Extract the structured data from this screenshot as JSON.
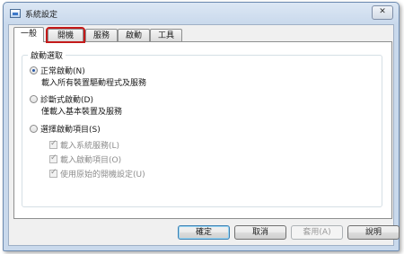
{
  "window": {
    "title": "系統設定",
    "close_glyph": "✕"
  },
  "tabs": [
    {
      "label": "一般",
      "active": true
    },
    {
      "label": "開機",
      "active": false
    },
    {
      "label": "服務",
      "active": false
    },
    {
      "label": "啟動",
      "active": false
    },
    {
      "label": "工具",
      "active": false
    }
  ],
  "startup": {
    "group_label": "啟動選取",
    "normal": {
      "label": "正常啟動(N)",
      "desc": "載入所有裝置驅動程式及服務",
      "selected": true
    },
    "diagnostic": {
      "label": "診斷式啟動(D)",
      "desc": "僅載入基本裝置及服務",
      "selected": false
    },
    "selective": {
      "label": "選擇啟動項目(S)",
      "selected": false,
      "options": [
        {
          "label": "載入系統服務(L)",
          "checked": true
        },
        {
          "label": "載入啟動項目(O)",
          "checked": true
        },
        {
          "label": "使用原始的開機設定(U)",
          "checked": true
        }
      ]
    }
  },
  "buttons": {
    "ok": "確定",
    "cancel": "取消",
    "apply": "套用(A)",
    "help": "說明"
  },
  "colors": {
    "highlight": "#c41a1a",
    "accent": "#2a5aa8"
  }
}
